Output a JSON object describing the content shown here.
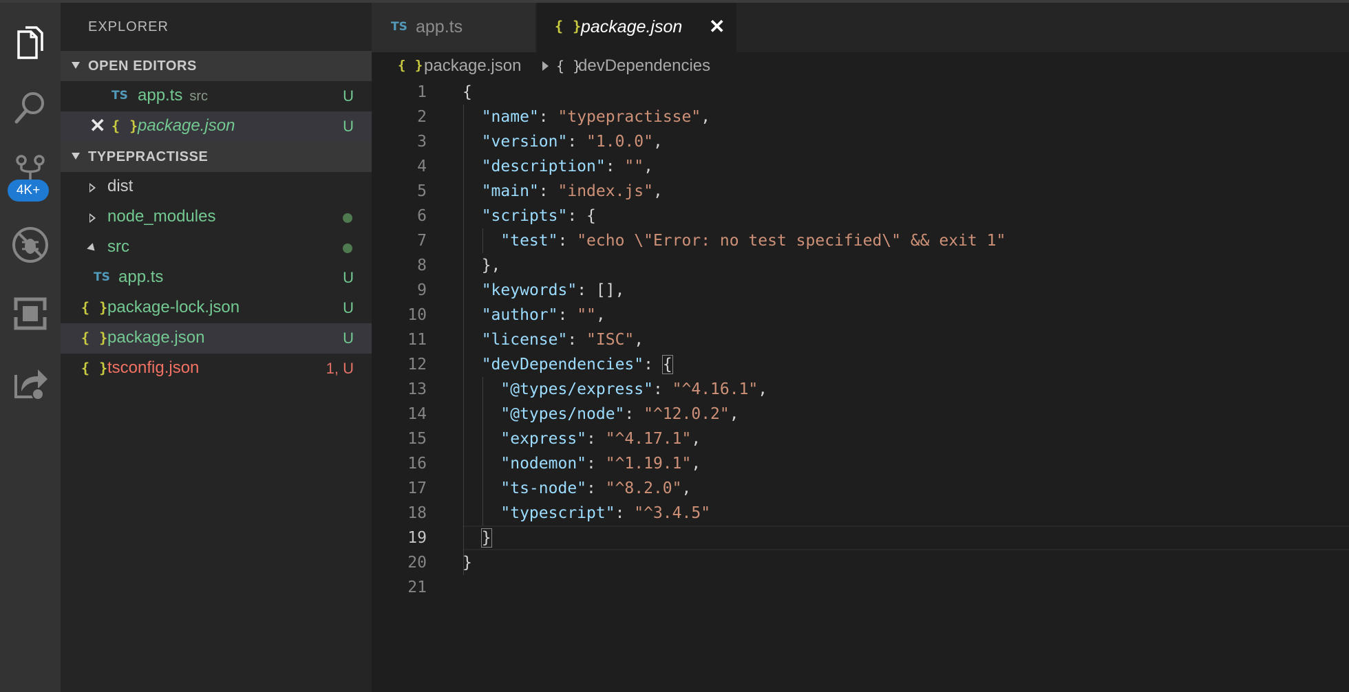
{
  "sidebar": {
    "title": "EXPLORER",
    "open_editors": {
      "header": "OPEN EDITORS",
      "items": [
        {
          "icon": "typescript-file-icon",
          "glyph": "TS",
          "name": "app.ts",
          "desc": "src",
          "status": "U"
        },
        {
          "icon": "json-file-icon",
          "glyph": "{ }",
          "name": "package.json",
          "status": "U",
          "close_glyph": "✕"
        }
      ]
    },
    "project": {
      "header": "TYPEPRACTISSE",
      "items": [
        {
          "name": "dist",
          "type": "folder"
        },
        {
          "name": "node_modules",
          "type": "folder"
        },
        {
          "name": "src",
          "type": "folder-open"
        },
        {
          "glyph": "TS",
          "name": "app.ts",
          "status": "U"
        },
        {
          "glyph": "{ }",
          "name": "package-lock.json",
          "status": "U"
        },
        {
          "glyph": "{ }",
          "name": "package.json",
          "status": "U"
        },
        {
          "glyph": "{ }",
          "name": "tsconfig.json",
          "status": "1, U"
        }
      ]
    }
  },
  "activity": {
    "scm_badge": "4K+"
  },
  "tabs": [
    {
      "glyph": "TS",
      "label": "app.ts"
    },
    {
      "glyph": "{ }",
      "label": "package.json",
      "close_glyph": "✕"
    }
  ],
  "breadcrumbs": {
    "file_glyph": "{ }",
    "file": "package.json",
    "symbol_glyph": "{ }",
    "symbol": "devDependencies"
  },
  "editor": {
    "line_numbers": [
      "1",
      "2",
      "3",
      "4",
      "5",
      "6",
      "7",
      "8",
      "9",
      "10",
      "11",
      "12",
      "13",
      "14",
      "15",
      "16",
      "17",
      "18",
      "19",
      "20",
      "21"
    ],
    "lines": [
      {
        "indent": "",
        "tokens": [
          {
            "c": "p",
            "t": "{"
          }
        ]
      },
      {
        "indent": "  ",
        "tokens": [
          {
            "c": "k",
            "t": "\"name\""
          },
          {
            "c": "p",
            "t": ": "
          },
          {
            "c": "s",
            "t": "\"typepractisse\""
          },
          {
            "c": "p",
            "t": ","
          }
        ]
      },
      {
        "indent": "  ",
        "tokens": [
          {
            "c": "k",
            "t": "\"version\""
          },
          {
            "c": "p",
            "t": ": "
          },
          {
            "c": "s",
            "t": "\"1.0.0\""
          },
          {
            "c": "p",
            "t": ","
          }
        ]
      },
      {
        "indent": "  ",
        "tokens": [
          {
            "c": "k",
            "t": "\"description\""
          },
          {
            "c": "p",
            "t": ": "
          },
          {
            "c": "s",
            "t": "\"\""
          },
          {
            "c": "p",
            "t": ","
          }
        ]
      },
      {
        "indent": "  ",
        "tokens": [
          {
            "c": "k",
            "t": "\"main\""
          },
          {
            "c": "p",
            "t": ": "
          },
          {
            "c": "s",
            "t": "\"index.js\""
          },
          {
            "c": "p",
            "t": ","
          }
        ]
      },
      {
        "indent": "  ",
        "tokens": [
          {
            "c": "k",
            "t": "\"scripts\""
          },
          {
            "c": "p",
            "t": ": {"
          }
        ]
      },
      {
        "indent": "    ",
        "tokens": [
          {
            "c": "k",
            "t": "\"test\""
          },
          {
            "c": "p",
            "t": ": "
          },
          {
            "c": "s",
            "t": "\"echo \\\"Error: no test specified\\\" && exit 1\""
          }
        ]
      },
      {
        "indent": "  ",
        "tokens": [
          {
            "c": "p",
            "t": "},"
          }
        ]
      },
      {
        "indent": "  ",
        "tokens": [
          {
            "c": "k",
            "t": "\"keywords\""
          },
          {
            "c": "p",
            "t": ": [],"
          }
        ]
      },
      {
        "indent": "  ",
        "tokens": [
          {
            "c": "k",
            "t": "\"author\""
          },
          {
            "c": "p",
            "t": ": "
          },
          {
            "c": "s",
            "t": "\"\""
          },
          {
            "c": "p",
            "t": ","
          }
        ]
      },
      {
        "indent": "  ",
        "tokens": [
          {
            "c": "k",
            "t": "\"license\""
          },
          {
            "c": "p",
            "t": ": "
          },
          {
            "c": "s",
            "t": "\"ISC\""
          },
          {
            "c": "p",
            "t": ","
          }
        ]
      },
      {
        "indent": "  ",
        "tokens": [
          {
            "c": "k",
            "t": "\"devDependencies\""
          },
          {
            "c": "p",
            "t": ": "
          },
          {
            "c": "p",
            "t": "{",
            "box": true
          }
        ]
      },
      {
        "indent": "    ",
        "tokens": [
          {
            "c": "k",
            "t": "\"@types/express\""
          },
          {
            "c": "p",
            "t": ": "
          },
          {
            "c": "s",
            "t": "\"^4.16.1\""
          },
          {
            "c": "p",
            "t": ","
          }
        ]
      },
      {
        "indent": "    ",
        "tokens": [
          {
            "c": "k",
            "t": "\"@types/node\""
          },
          {
            "c": "p",
            "t": ": "
          },
          {
            "c": "s",
            "t": "\"^12.0.2\""
          },
          {
            "c": "p",
            "t": ","
          }
        ]
      },
      {
        "indent": "    ",
        "tokens": [
          {
            "c": "k",
            "t": "\"express\""
          },
          {
            "c": "p",
            "t": ": "
          },
          {
            "c": "s",
            "t": "\"^4.17.1\""
          },
          {
            "c": "p",
            "t": ","
          }
        ]
      },
      {
        "indent": "    ",
        "tokens": [
          {
            "c": "k",
            "t": "\"nodemon\""
          },
          {
            "c": "p",
            "t": ": "
          },
          {
            "c": "s",
            "t": "\"^1.19.1\""
          },
          {
            "c": "p",
            "t": ","
          }
        ]
      },
      {
        "indent": "    ",
        "tokens": [
          {
            "c": "k",
            "t": "\"ts-node\""
          },
          {
            "c": "p",
            "t": ": "
          },
          {
            "c": "s",
            "t": "\"^8.2.0\""
          },
          {
            "c": "p",
            "t": ","
          }
        ]
      },
      {
        "indent": "    ",
        "tokens": [
          {
            "c": "k",
            "t": "\"typescript\""
          },
          {
            "c": "p",
            "t": ": "
          },
          {
            "c": "s",
            "t": "\"^3.4.5\""
          }
        ]
      },
      {
        "indent": "  ",
        "tokens": [
          {
            "c": "p",
            "t": "}",
            "box": true
          }
        ]
      },
      {
        "indent": "",
        "tokens": [
          {
            "c": "p",
            "t": "}"
          }
        ]
      },
      {
        "indent": "",
        "tokens": []
      }
    ],
    "current_line": 19
  },
  "colors": {
    "accent_badge": "#1f7ad4",
    "untracked_green": "#73c991",
    "error_red": "#f27262",
    "json_key": "#9cdcfe",
    "json_string": "#ce9178"
  }
}
